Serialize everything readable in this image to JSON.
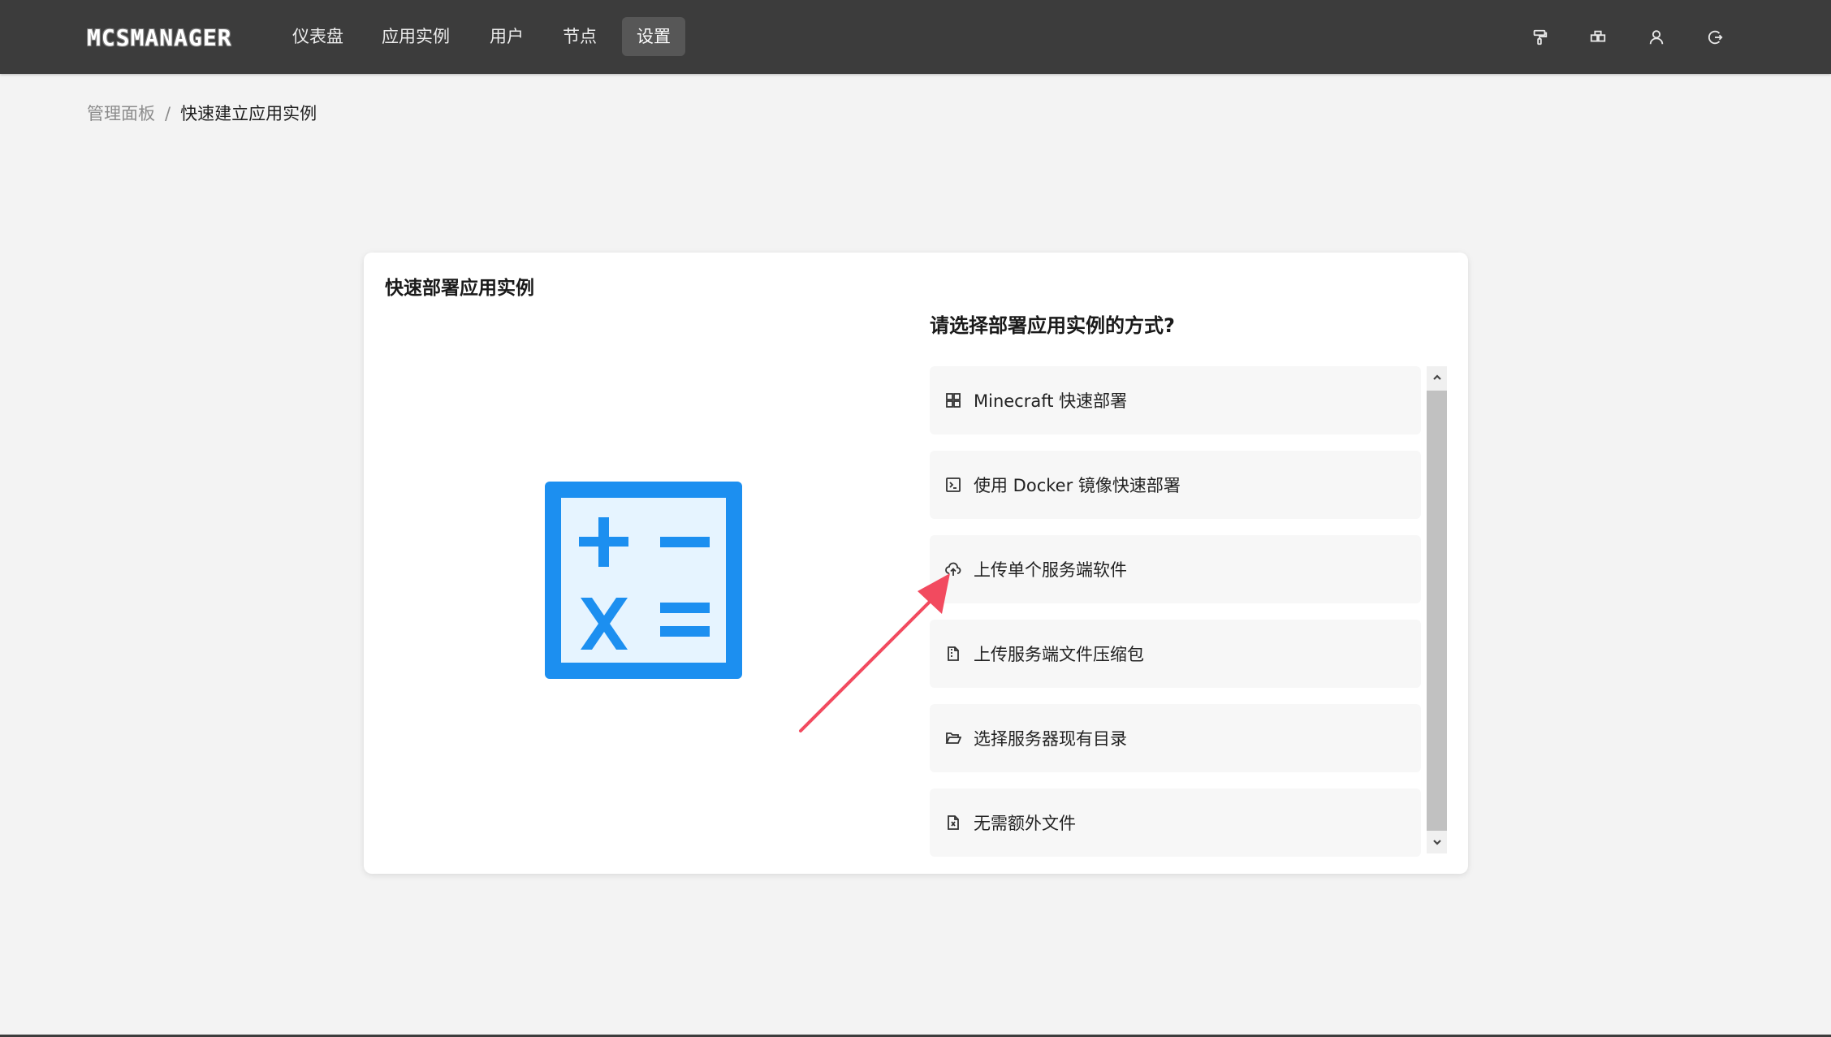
{
  "app": {
    "logo_text": "MCSMANAGER"
  },
  "nav": {
    "items": [
      {
        "label": "仪表盘"
      },
      {
        "label": "应用实例"
      },
      {
        "label": "用户"
      },
      {
        "label": "节点"
      },
      {
        "label": "设置",
        "active": true
      }
    ],
    "right_icons": [
      "paint-roller-icon",
      "layout-icon",
      "user-icon",
      "logout-icon"
    ]
  },
  "breadcrumb": {
    "parent": "管理面板",
    "separator": "/",
    "current": "快速建立应用实例"
  },
  "card": {
    "title": "快速部署应用实例",
    "illustration": "calculator-icon",
    "question": "请选择部署应用实例的方式?",
    "options": [
      {
        "label": "Minecraft 快速部署",
        "icon": "apps-icon"
      },
      {
        "label": "使用 Docker 镜像快速部署",
        "icon": "terminal-icon"
      },
      {
        "label": "上传单个服务端软件",
        "icon": "cloud-upload-icon"
      },
      {
        "label": "上传服务端文件压缩包",
        "icon": "file-zip-icon"
      },
      {
        "label": "选择服务器现有目录",
        "icon": "folder-open-icon"
      },
      {
        "label": "无需额外文件",
        "icon": "file-excel-icon"
      }
    ]
  },
  "colors": {
    "topbar": "#3c3c3c",
    "accent_blue": "#1c8ff0",
    "annotation_red": "#f24a5f"
  }
}
